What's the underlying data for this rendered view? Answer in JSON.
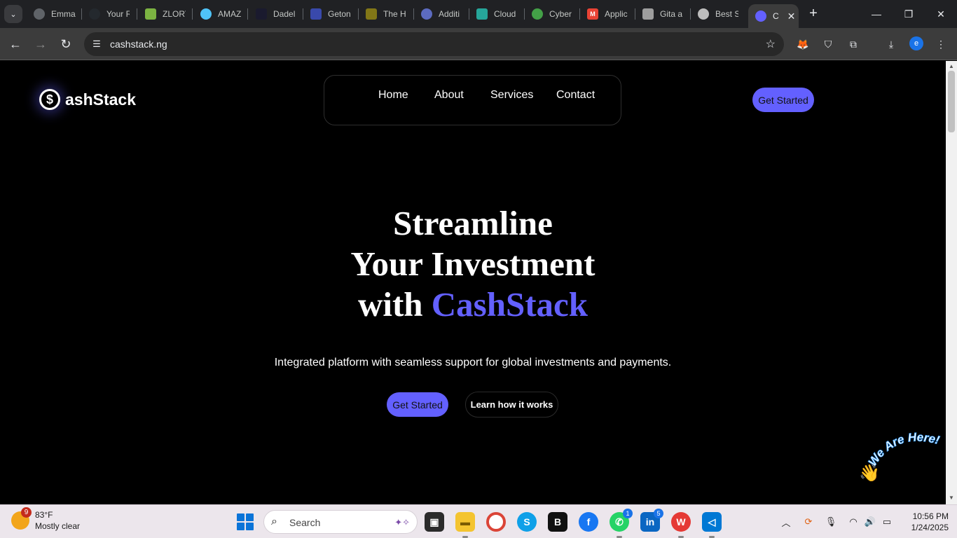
{
  "browser": {
    "tabs": [
      {
        "label": "Emma",
        "favicon": "chrome-icon",
        "color": "#5f6368"
      },
      {
        "label": "Your R",
        "favicon": "github-icon",
        "color": "#24292e"
      },
      {
        "label": "ZLORY",
        "favicon": "zlory-icon",
        "color": "#7cb342"
      },
      {
        "label": "AMAZ",
        "favicon": "amaz-icon",
        "color": "#4fc3f7"
      },
      {
        "label": "Dadel",
        "favicon": "dadel-icon",
        "color": "#1a1a2e"
      },
      {
        "label": "Geton",
        "favicon": "geton-icon",
        "color": "#3949ab"
      },
      {
        "label": "The H",
        "favicon": "the-h-icon",
        "color": "#827717"
      },
      {
        "label": "Additi",
        "favicon": "additi-icon",
        "color": "#5c6bc0"
      },
      {
        "label": "Cloud",
        "favicon": "cloud-icon",
        "color": "#26a69a"
      },
      {
        "label": "Cyber",
        "favicon": "cyber-icon",
        "color": "#43a047"
      },
      {
        "label": "Applic",
        "favicon": "gmail-icon",
        "color": "#ea4335"
      },
      {
        "label": "Gita a",
        "favicon": "gita-icon",
        "color": "#9e9e9e"
      },
      {
        "label": "Best S",
        "favicon": "best-s-icon",
        "color": "#bdbdbd"
      }
    ],
    "active_tab": {
      "label": "C",
      "favicon": "cashstack-icon"
    },
    "url": "cashstack.ng",
    "profile_initial": "e"
  },
  "site": {
    "brand_mark": "$",
    "brand_name": "ashStack",
    "nav": [
      "Home",
      "About",
      "Services",
      "Contact"
    ],
    "header_cta": "Get Started",
    "hero": {
      "line1": "Streamline",
      "line2": "Your Investment",
      "line3_prefix": "with ",
      "line3_accent": "CashStack"
    },
    "subtitle": "Integrated platform with seamless support for global investments and payments.",
    "cta_primary": "Get Started",
    "cta_secondary": "Learn how it works",
    "badge_text": "We Are Here!",
    "accent_color": "#6360ff"
  },
  "taskbar": {
    "weather_temp": "83°F",
    "weather_desc": "Mostly clear",
    "weather_badge": "9",
    "search_placeholder": "Search",
    "whatsapp_count": "1",
    "linkedin_count": "5",
    "time": "10:56 PM",
    "date": "1/24/2025"
  }
}
